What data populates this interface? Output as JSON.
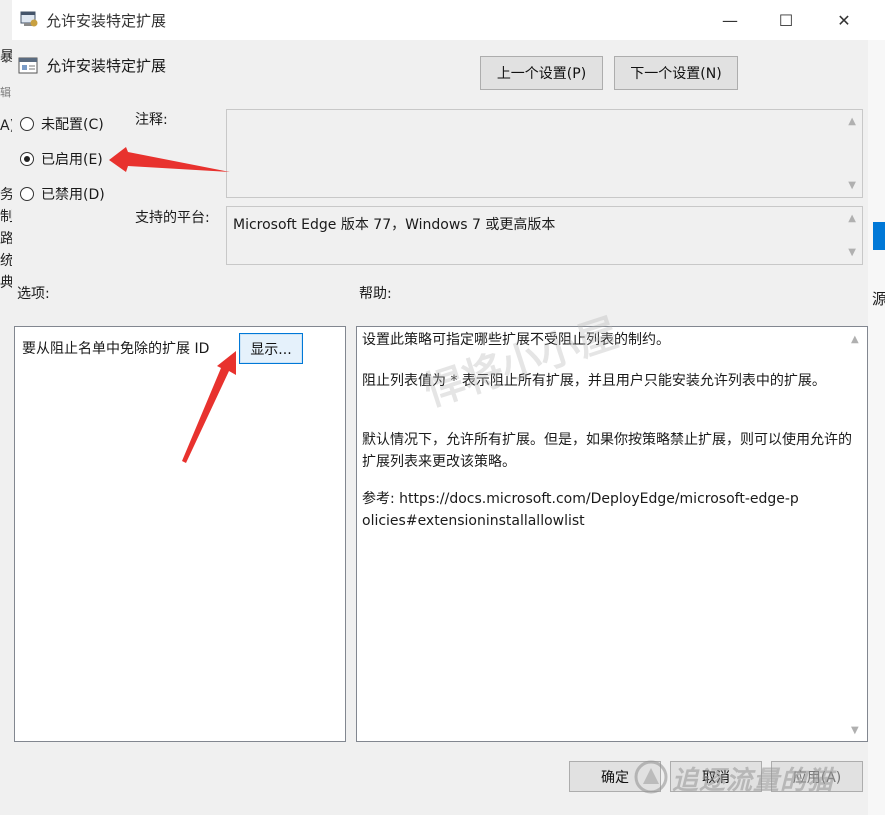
{
  "window": {
    "title": "允许安装特定扩展",
    "minimize": "—",
    "maximize": "☐",
    "close": "✕"
  },
  "header": {
    "policy_title": "允许安装特定扩展",
    "prev_button": "上一个设置(P)",
    "next_button": "下一个设置(N)"
  },
  "state": {
    "options": [
      {
        "label": "未配置(C)",
        "selected": false
      },
      {
        "label": "已启用(E)",
        "selected": true
      },
      {
        "label": "已禁用(D)",
        "selected": false
      }
    ]
  },
  "comment": {
    "label": "注释:",
    "value": ""
  },
  "platform": {
    "label": "支持的平台:",
    "value": "Microsoft Edge 版本 77，Windows 7 或更高版本"
  },
  "options_section": {
    "label": "选项:",
    "exempt_label": "要从阻止名单中免除的扩展 ID",
    "show_button": "显示..."
  },
  "help_section": {
    "label": "帮助:",
    "paragraphs": [
      "设置此策略可指定哪些扩展不受阻止列表的制约。",
      "阻止列表值为 * 表示阻止所有扩展，并且用户只能安装允许列表中的扩展。",
      "默认情况下，允许所有扩展。但是，如果你按策略禁止扩展，则可以使用允许的扩展列表来更改该策略。",
      "参考: https://docs.microsoft.com/DeployEdge/microsoft-edge-policies#extensioninstallallowlist"
    ]
  },
  "footer": {
    "ok_button": "确定",
    "cancel_button": "取消",
    "apply_button": "应用(A)"
  },
  "background": {
    "left_chars": [
      "暴",
      "辑",
      "A)",
      "务",
      "制",
      "路",
      "统",
      "典"
    ],
    "right_char": "源"
  },
  "watermark": {
    "text": "追逐流量的猫",
    "center_text": "悍将小小屋"
  },
  "colors": {
    "dialog_bg": "#f0f0f0",
    "arrow": "#e8322e",
    "focus_border": "#0078d7"
  }
}
